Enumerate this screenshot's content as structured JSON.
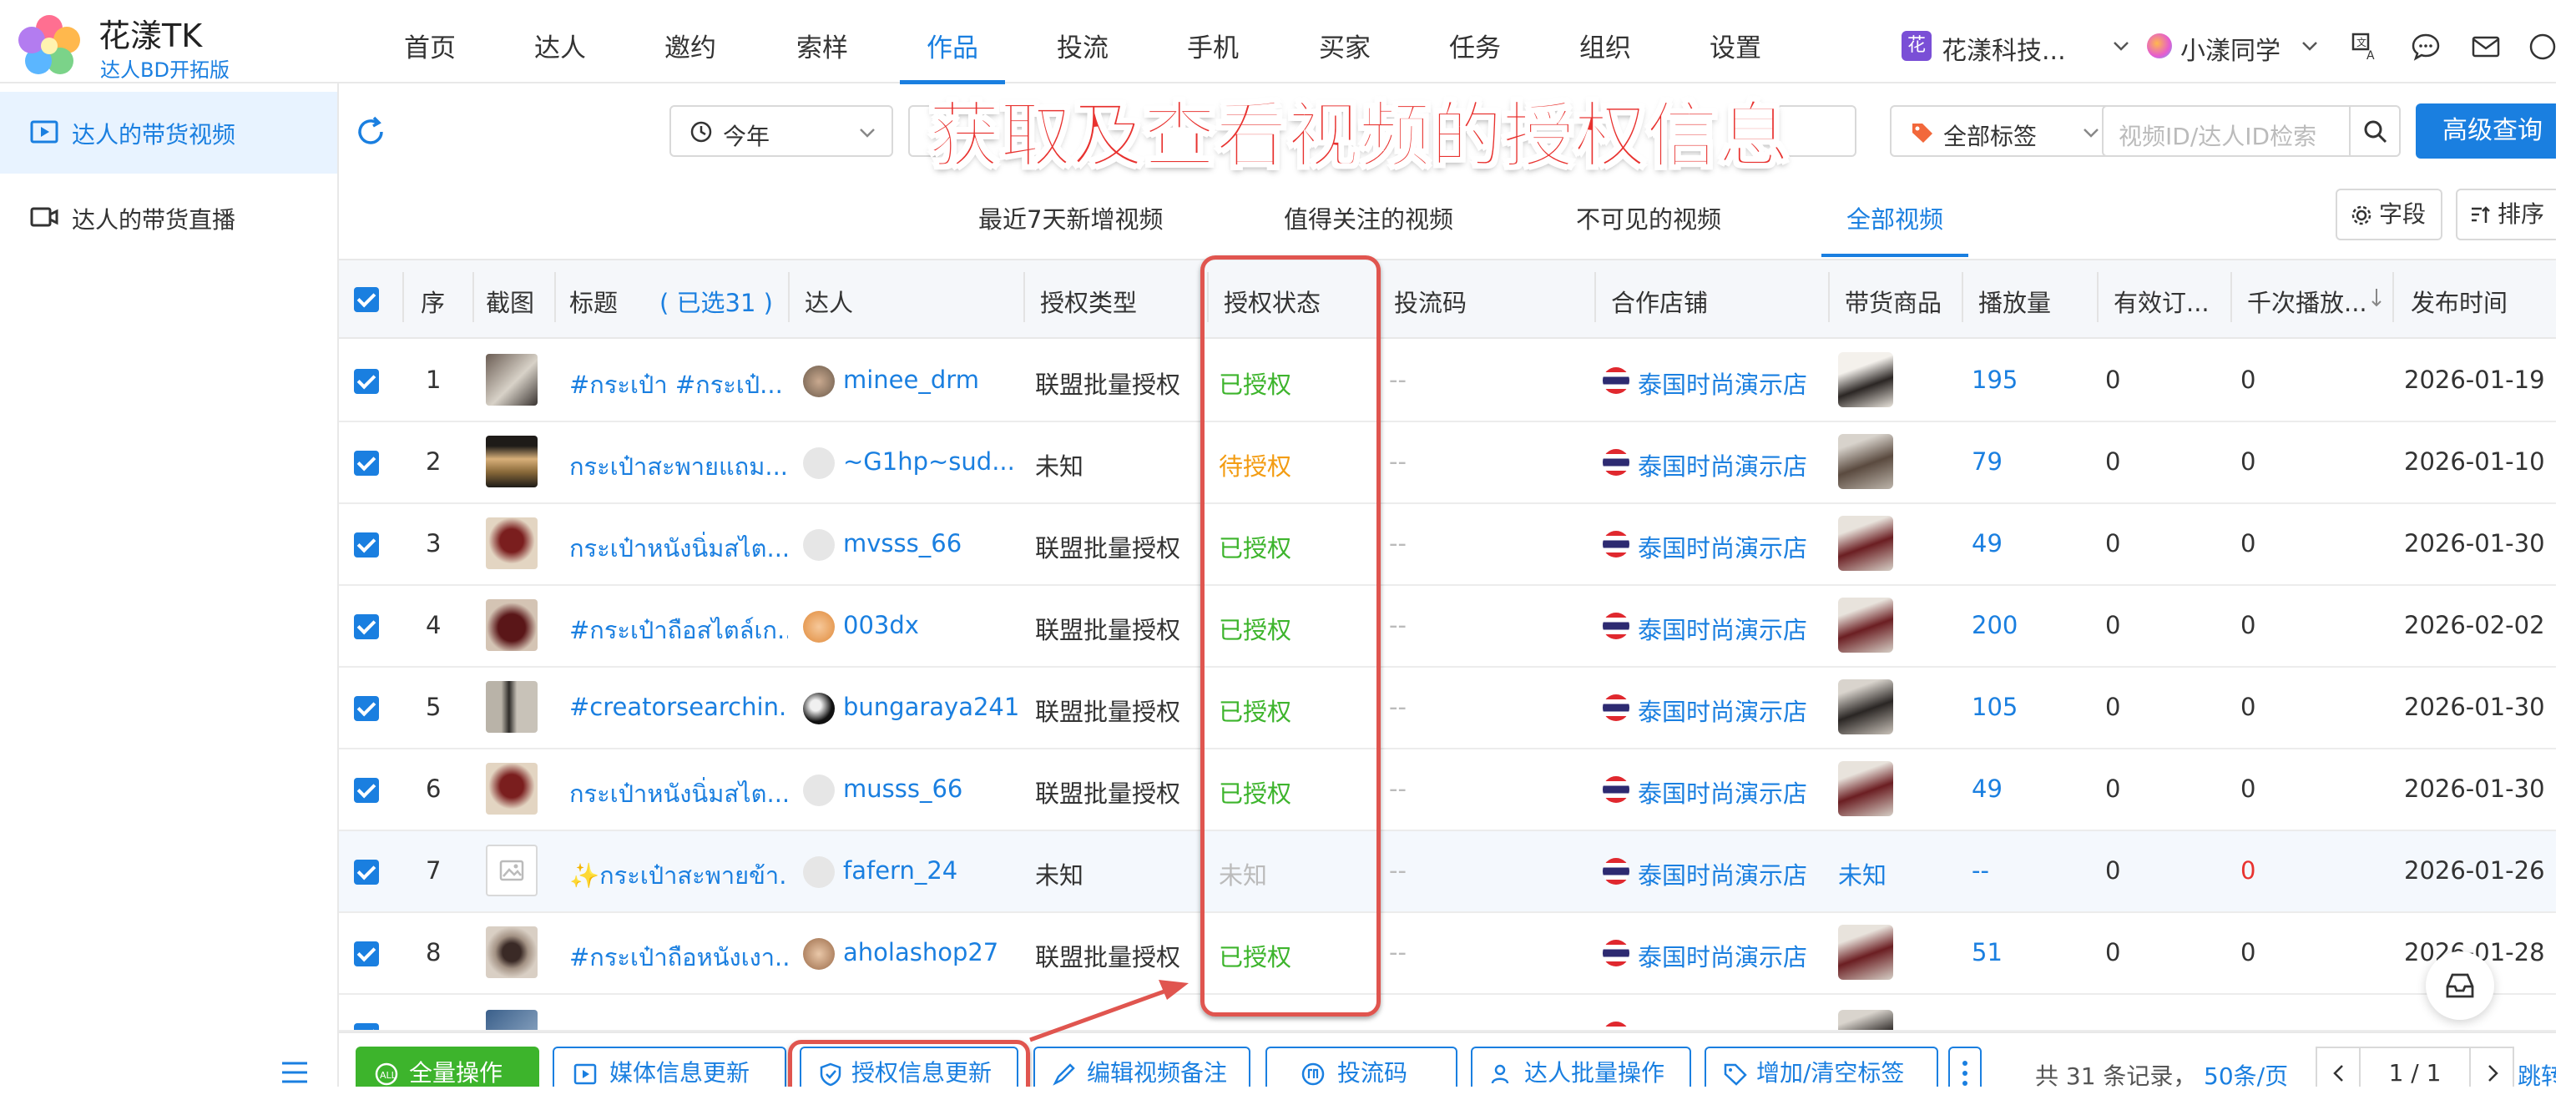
{
  "brand": {
    "name": "花漾TK",
    "subtitle": "达人BD开拓版"
  },
  "nav": {
    "items": [
      "首页",
      "达人",
      "邀约",
      "索样",
      "作品",
      "投流",
      "手机",
      "买家",
      "任务",
      "组织",
      "设置"
    ],
    "active": "作品"
  },
  "header": {
    "org_badge": "花",
    "org_name": "花漾科技...",
    "user_name": "小漾同学"
  },
  "sidebar": {
    "items": [
      "达人的带货视频",
      "达人的带货直播"
    ],
    "active": "达人的带货视频"
  },
  "filters": {
    "date_range": "今年",
    "tag_filter": "全部标签",
    "search_placeholder": "视频ID/达人ID检索",
    "advanced_search": "高级查询"
  },
  "overlay_title": "获取及查看视频的授权信息",
  "subtabs": {
    "items": [
      "最近7天新增视频",
      "值得关注的视频",
      "不可见的视频",
      "全部视频"
    ],
    "active": "全部视频"
  },
  "tools": {
    "fields": "字段",
    "sort": "排序"
  },
  "table": {
    "headers": {
      "index": "序",
      "screenshot": "截图",
      "title": "标题",
      "selected": "( 已选31 )",
      "creator": "达人",
      "auth_type": "授权类型",
      "auth_status": "授权状态",
      "ad_code": "投流码",
      "shop": "合作店铺",
      "product": "带货商品",
      "plays": "播放量",
      "orders": "有效订...",
      "per_k": "千次播放...",
      "published": "发布时间"
    },
    "rows": [
      {
        "index": "1",
        "title": "#กระเป๋า #กระเป๋...",
        "creator": "minee_drm",
        "auth_type": "联盟批量授权",
        "auth_status": "已授权",
        "status_kind": "authorized",
        "ad_code": "--",
        "shop": "泰国时尚演示店",
        "plays": "195",
        "orders": "0",
        "per_k": "0",
        "published": "2026-01-19"
      },
      {
        "index": "2",
        "title": "กระเป๋าสะพายแถม...",
        "creator": "~G1hp~sud...",
        "auth_type": "未知",
        "auth_status": "待授权",
        "status_kind": "pending",
        "ad_code": "--",
        "shop": "泰国时尚演示店",
        "plays": "79",
        "orders": "0",
        "per_k": "0",
        "published": "2026-01-10"
      },
      {
        "index": "3",
        "title": "กระเป๋าหนังนิ่มสไต...",
        "creator": "mvsss_66",
        "auth_type": "联盟批量授权",
        "auth_status": "已授权",
        "status_kind": "authorized",
        "ad_code": "--",
        "shop": "泰国时尚演示店",
        "plays": "49",
        "orders": "0",
        "per_k": "0",
        "published": "2026-01-30"
      },
      {
        "index": "4",
        "title": "#กระเป๋าถือสไตล์เก...",
        "creator": "003dx",
        "auth_type": "联盟批量授权",
        "auth_status": "已授权",
        "status_kind": "authorized",
        "ad_code": "--",
        "shop": "泰国时尚演示店",
        "plays": "200",
        "orders": "0",
        "per_k": "0",
        "published": "2026-02-02"
      },
      {
        "index": "5",
        "title": "#creatorsearchin...",
        "creator": "bungaraya241",
        "auth_type": "联盟批量授权",
        "auth_status": "已授权",
        "status_kind": "authorized",
        "ad_code": "--",
        "shop": "泰国时尚演示店",
        "plays": "105",
        "orders": "0",
        "per_k": "0",
        "published": "2026-01-30"
      },
      {
        "index": "6",
        "title": "กระเป๋าหนังนิ่มสไต...",
        "creator": "musss_66",
        "auth_type": "联盟批量授权",
        "auth_status": "已授权",
        "status_kind": "authorized",
        "ad_code": "--",
        "shop": "泰国时尚演示店",
        "plays": "49",
        "orders": "0",
        "per_k": "0",
        "published": "2026-01-30"
      },
      {
        "index": "7",
        "title": "✨กระเป๋าสะพายข้า...",
        "creator": "fafern_24",
        "auth_type": "未知",
        "auth_status": "未知",
        "status_kind": "unknown",
        "ad_code": "--",
        "shop": "泰国时尚演示店",
        "product_text": "未知",
        "plays": "--",
        "orders": "0",
        "per_k": "0",
        "published": "2026-01-26"
      },
      {
        "index": "8",
        "title": "#กระเป๋าถือหนังเงา...",
        "creator": "aholashop27",
        "auth_type": "联盟批量授权",
        "auth_status": "已授权",
        "status_kind": "authorized",
        "ad_code": "--",
        "shop": "泰国时尚演示店",
        "plays": "51",
        "orders": "0",
        "per_k": "0",
        "published": "2026-01-28"
      }
    ]
  },
  "bottom_bar": {
    "buttons": [
      "全量操作",
      "媒体信息更新",
      "授权信息更新",
      "编辑视频备注",
      "投流码",
      "达人批量操作",
      "增加/清空标签"
    ],
    "total": "共 31 条记录，",
    "per_page": "50条/页",
    "page": "1 / 1",
    "jump": "跳转"
  },
  "colors": {
    "accent": "#1a7fe0",
    "authorized": "#3db42c",
    "pending": "#f39c12",
    "unknown": "#bbbbbb",
    "annotation": "#e0554f"
  }
}
